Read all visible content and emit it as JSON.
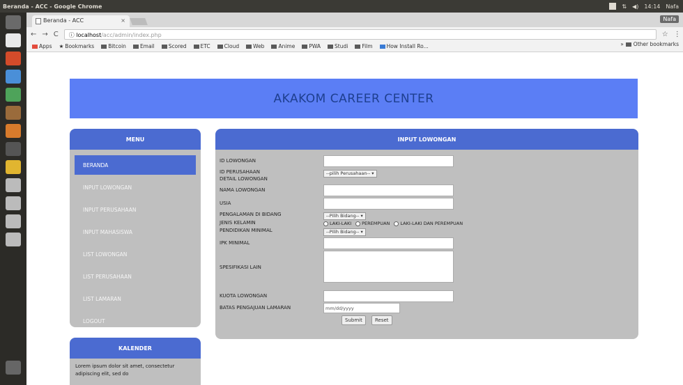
{
  "os": {
    "window_title": "Beranda - ACC - Google Chrome",
    "tray_time": "14:14",
    "tray_user": "Nafa"
  },
  "browser": {
    "tab_title": "Beranda - ACC",
    "tab_close": "×",
    "user_label": "Nafa",
    "url_host": "localhost",
    "url_path": "/acc/admin/index.php",
    "nav_back": "←",
    "nav_forward": "→",
    "nav_reload": "C",
    "star": "☆",
    "menu": "⋮",
    "bookmarks": [
      "Apps",
      "Bookmarks",
      "Bitcoin",
      "Email",
      "Scored",
      "ETC",
      "Cloud",
      "Web",
      "Anime",
      "PWA",
      "Studi",
      "Film",
      "How Install Ro..."
    ],
    "other_bookmarks": "Other bookmarks"
  },
  "page": {
    "header_title": "AKAKOM CAREER CENTER",
    "menu": {
      "title": "MENU",
      "items": [
        "BERANDA",
        "INPUT LOWONGAN",
        "INPUT PERUSAHAAN",
        "INPUT MAHASISWA",
        "LIST LOWONGAN",
        "LIST PERUSAHAAN",
        "LIST LAMARAN",
        "LOGOUT"
      ]
    },
    "calendar": {
      "title": "KALENDER",
      "text": "Lorem ipsum dolor sit amet, consectetur adipiscing elit, sed do"
    },
    "form": {
      "title": "INPUT LOWONGAN",
      "labels": {
        "id_lowongan": "ID LOWONGAN",
        "id_perusahaan": "ID PERUSAHAAN",
        "detail": "DETAIL LOWONGAN",
        "nama": "NAMA LOWONGAN",
        "usia": "USIA",
        "pengalaman": "PENGALAMAN DI BIDANG",
        "jenis_kelamin": "JENIS KELAMIN",
        "pendidikan": "PENDIDIKAN MINIMAL",
        "ipk": "IPK MINIMAL",
        "spesifikasi": "SPESIFIKASI LAIN",
        "kuota": "KUOTA LOWONGAN",
        "batas": "BATAS PENGAJUAN LAMARAN"
      },
      "selects": {
        "perusahaan": "--pilih Perusahaan-- ▾",
        "bidang": "--Pilih Bidang--          ▾",
        "pendidikan": "--Pilih Bidang-- ▾"
      },
      "radio_options": [
        "LAKI-LAKI",
        "PEREMPUAN",
        "LAKI-LAKI DAN PEREMPUAN"
      ],
      "date_placeholder": "mm/dd/yyyy",
      "submit_label": "Submit",
      "reset_label": "Reset"
    }
  }
}
